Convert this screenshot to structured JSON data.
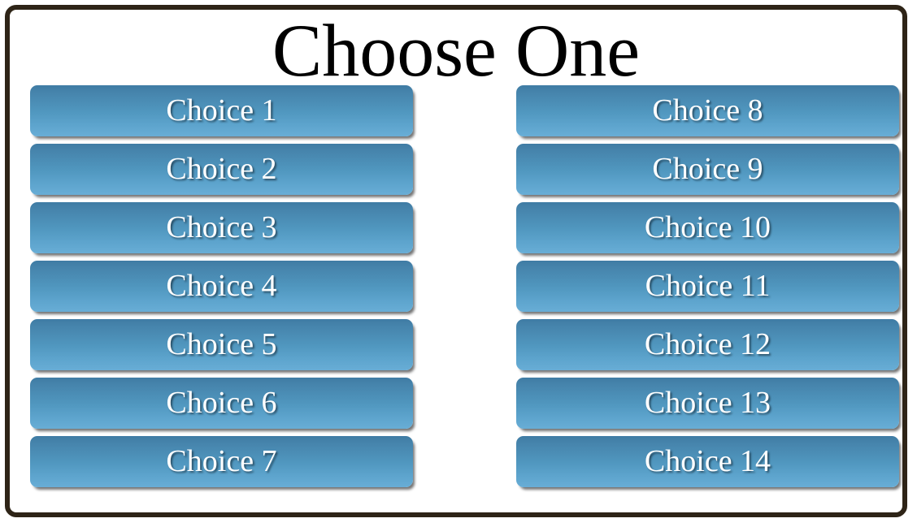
{
  "dialog": {
    "title": "Choose One",
    "border_color": "#2e2417",
    "background_color": "#ffffff"
  },
  "buttons": {
    "gradient_top": "#3f7ba4",
    "gradient_bottom": "#68add6",
    "text_color": "#ffffff",
    "left_column": [
      {
        "label": "Choice 1"
      },
      {
        "label": "Choice 2"
      },
      {
        "label": "Choice 3"
      },
      {
        "label": "Choice 4"
      },
      {
        "label": "Choice 5"
      },
      {
        "label": "Choice 6"
      },
      {
        "label": "Choice 7"
      }
    ],
    "right_column": [
      {
        "label": "Choice 8"
      },
      {
        "label": "Choice 9"
      },
      {
        "label": "Choice 10"
      },
      {
        "label": "Choice 11"
      },
      {
        "label": "Choice 12"
      },
      {
        "label": "Choice 13"
      },
      {
        "label": "Choice 14"
      }
    ]
  }
}
